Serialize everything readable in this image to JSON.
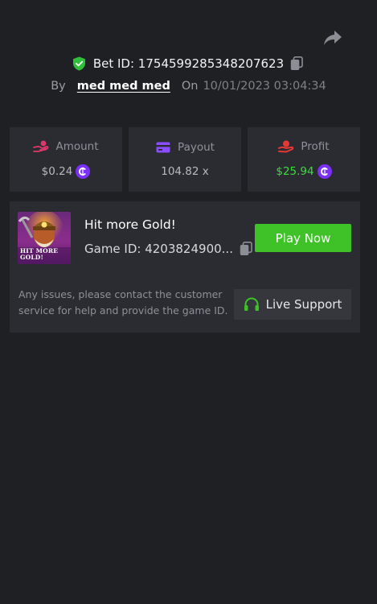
{
  "header": {
    "share_icon": "share-arrow-icon",
    "bet_id_label": "Bet ID: 1754599285348207623",
    "by_label": "By",
    "username": "med med med",
    "on_label": "On",
    "datetime": "10/01/2023 03:04:34"
  },
  "stats": [
    {
      "label": "Amount",
      "value": "$0.24",
      "icon": "hand-coin-icon",
      "icon_color": "#e0386b",
      "show_coin": true
    },
    {
      "label": "Payout",
      "value": "104.82 x",
      "icon": "card-icon",
      "icon_color": "#8a4dff",
      "show_coin": false
    },
    {
      "label": "Profit",
      "value": "$25.94",
      "icon": "hand-money-icon",
      "icon_color": "#e53935",
      "show_coin": true,
      "value_color": "#3cdc3c"
    }
  ],
  "game": {
    "thumb_text_line1": "HIT MORE",
    "thumb_text_line2": "GOLD!",
    "title": "Hit more Gold!",
    "game_id_label": "Game ID: 4203824900...",
    "play_label": "Play Now"
  },
  "support": {
    "text": "Any issues, please contact the customer service for help and provide the game ID.",
    "button_label": "Live Support"
  },
  "colors": {
    "background": "#1f2024",
    "card": "#2a2c31",
    "accent_green": "#3ec227",
    "coin_purple": "#7b2ff7"
  }
}
